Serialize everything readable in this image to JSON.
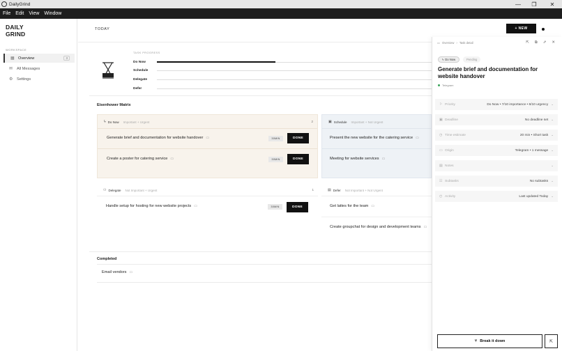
{
  "window": {
    "title": "DailyGrind",
    "minimize": "—",
    "maximize": "❐",
    "close": "✕"
  },
  "menu": [
    "File",
    "Edit",
    "View",
    "Window"
  ],
  "sidebar": {
    "logo_line1": "DAILY",
    "logo_line2": "GRIND",
    "section_label": "WORKSPACE",
    "items": [
      {
        "label": "Overview",
        "icon": "grid-icon",
        "count": "3"
      },
      {
        "label": "All Messages",
        "icon": "mail-icon"
      },
      {
        "label": "Settings",
        "icon": "gear-icon"
      }
    ]
  },
  "header": {
    "title": "TODAY",
    "new_label": "+ NEW"
  },
  "progress": {
    "title": "TASK PROGRESS",
    "rows": [
      {
        "label": "Do Now",
        "fraction": 0.43
      },
      {
        "label": "Schedule",
        "fraction": 0
      },
      {
        "label": "Delegate",
        "fraction": 0
      },
      {
        "label": "Defer",
        "fraction": 0
      }
    ]
  },
  "matrix": {
    "title": "Eisenhower Matrix",
    "quadrants": {
      "do_now": {
        "name": "Do Now",
        "sub": "Important + Urgent",
        "count": "2",
        "tasks": [
          {
            "title": "Generate brief and documentation for website handover",
            "duration": "30MIN",
            "done": "DONE"
          },
          {
            "title": "Create a poster for catering service",
            "duration": "30MIN",
            "done": "DONE"
          }
        ]
      },
      "schedule": {
        "name": "Schedule",
        "sub": "Important + Not Urgent",
        "tasks": [
          {
            "title": "Present the new website for the catering service"
          },
          {
            "title": "Meeting for website services"
          }
        ]
      },
      "delegate": {
        "name": "Delegate",
        "sub": "Not Important + Urgent",
        "count": "1",
        "tasks": [
          {
            "title": "Handle setup for hosting for new website projects",
            "duration": "30MIN",
            "done": "DONE"
          }
        ]
      },
      "defer": {
        "name": "Defer",
        "sub": "Not Important + Not Urgent",
        "tasks": [
          {
            "title": "Get lattes for the team"
          },
          {
            "title": "Create groupchat for design and development teams"
          }
        ]
      }
    }
  },
  "completed": {
    "title": "Completed",
    "tasks": [
      {
        "title": "Email vendors"
      }
    ]
  },
  "panel": {
    "breadcrumb_root": "Overview",
    "breadcrumb_sep": "›",
    "breadcrumb_current": "Task detail",
    "chip_active": "Do Now",
    "chip_pending": "Pending",
    "title": "Generate brief and documentation for website handover",
    "source": "Telegram",
    "fields": [
      {
        "label": "Priority",
        "value": "Do Now • 7/10 importance • 6/10 urgency",
        "icon": "flag-icon"
      },
      {
        "label": "Deadline",
        "value": "No deadline set",
        "icon": "calendar-icon"
      },
      {
        "label": "Time estimate",
        "value": "20 min • Short task",
        "icon": "clock-icon"
      },
      {
        "label": "Origin",
        "value": "Telegram • 1 message",
        "icon": "chat-icon"
      },
      {
        "label": "Notes",
        "value": "",
        "icon": "note-icon"
      },
      {
        "label": "Subtasks",
        "value": "No subtasks",
        "icon": "list-icon"
      },
      {
        "label": "Activity",
        "value": "Last updated Today",
        "icon": "history-icon"
      }
    ],
    "break_label": "Break it down"
  },
  "colors": {
    "do_now_bg": "#f8f3ec",
    "schedule_bg": "#eef2f6",
    "accent": "#111111"
  }
}
